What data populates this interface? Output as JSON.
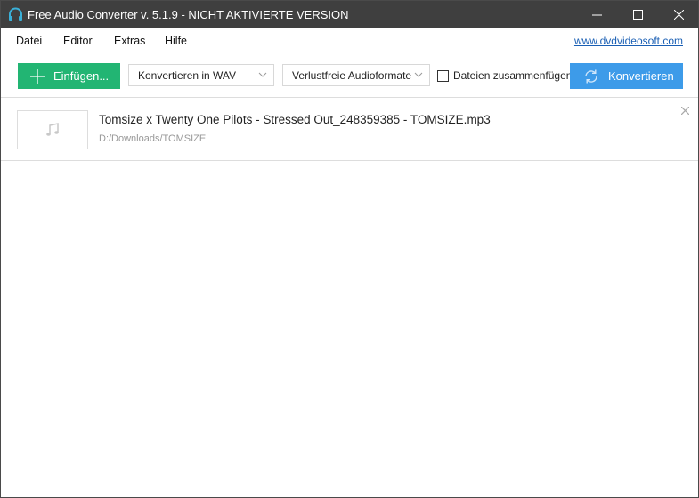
{
  "window": {
    "title": "Free Audio Converter v. 5.1.9 - NICHT AKTIVIERTE VERSION"
  },
  "menu": {
    "items": [
      "Datei",
      "Editor",
      "Extras",
      "Hilfe"
    ],
    "link": "www.dvdvideosoft.com"
  },
  "toolbar": {
    "add_label": "Einfügen...",
    "format_select": "Konvertieren in WAV",
    "preset_select": "Verlustfreie Audioformate",
    "merge_label": "Dateien zusammenfügen",
    "merge_checked": false,
    "convert_label": "Konvertieren"
  },
  "files": [
    {
      "name": "Tomsize x Twenty One Pilots - Stressed Out_248359385 - TOMSIZE.mp3",
      "path": "D:/Downloads/TOMSIZE"
    }
  ],
  "colors": {
    "add": "#22b573",
    "convert": "#3d9be9",
    "titlebar": "#3f3f3f",
    "link": "#1a5fb4"
  }
}
